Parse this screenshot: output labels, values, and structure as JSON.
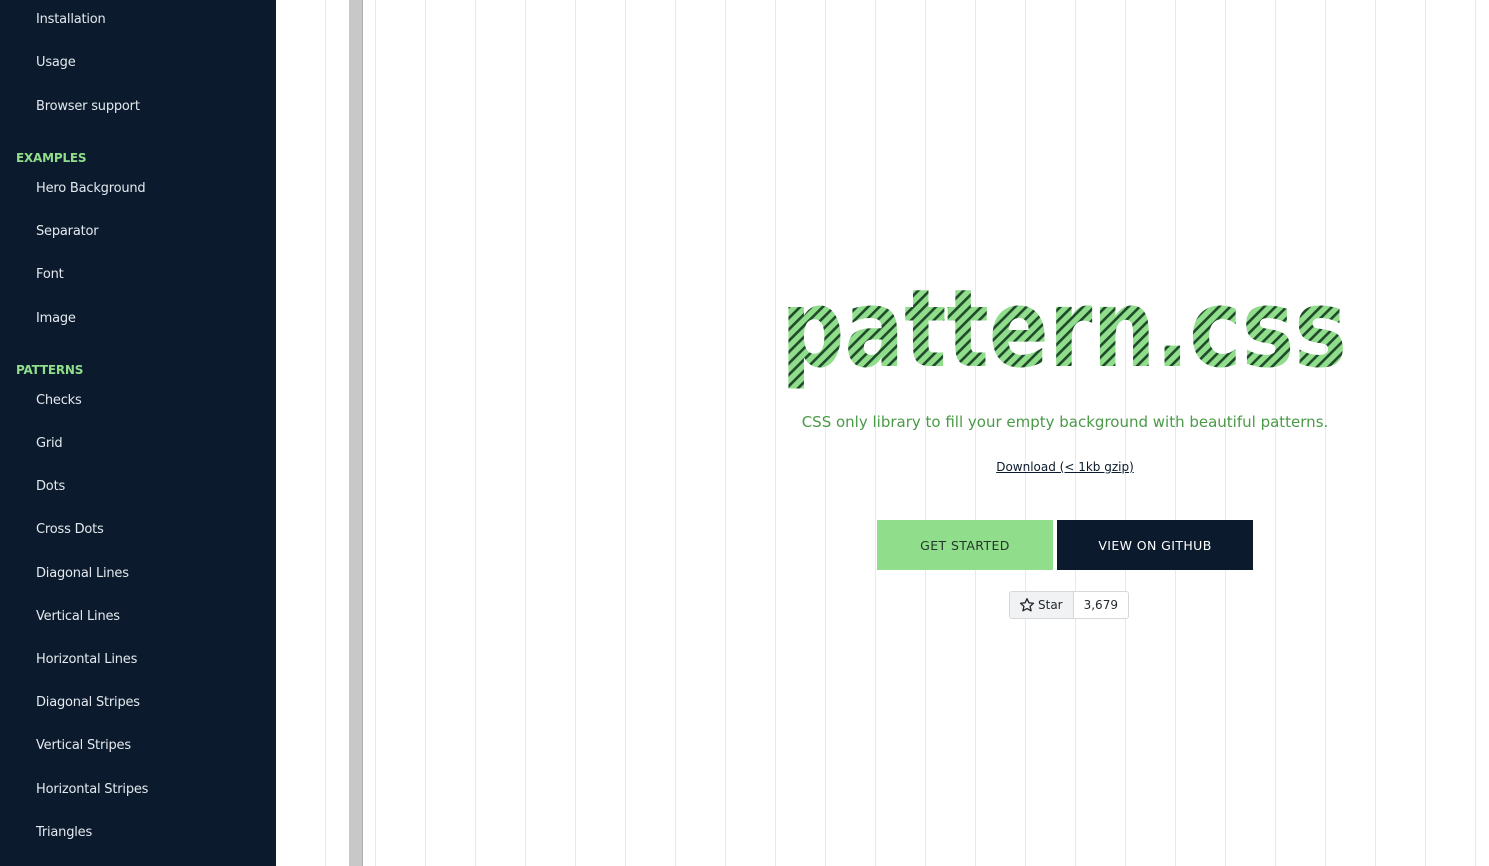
{
  "sidebar": {
    "top_items": [
      "Installation",
      "Usage",
      "Browser support"
    ],
    "examples_heading": "EXAMPLES",
    "examples": [
      "Hero Background",
      "Separator",
      "Font",
      "Image"
    ],
    "patterns_heading": "PATTERNS",
    "patterns": [
      "Checks",
      "Grid",
      "Dots",
      "Cross Dots",
      "Diagonal Lines",
      "Vertical Lines",
      "Horizontal Lines",
      "Diagonal Stripes",
      "Vertical Stripes",
      "Horizontal Stripes",
      "Triangles"
    ]
  },
  "hero": {
    "title": "pattern.css",
    "tagline": "CSS only library to fill your empty background with beautiful patterns.",
    "download_link": "Download (< 1kb gzip)",
    "get_started_label": "GET STARTED",
    "github_label": "VIEW ON GITHUB",
    "star_label": "Star",
    "star_count": "3,679"
  },
  "colors": {
    "sidebar_bg": "#0b1a2c",
    "accent_green": "#90dd8b",
    "text_green": "#4a9a47",
    "dark_navy": "#0b1a2c"
  },
  "icons": {
    "star": "star-outline-icon"
  }
}
